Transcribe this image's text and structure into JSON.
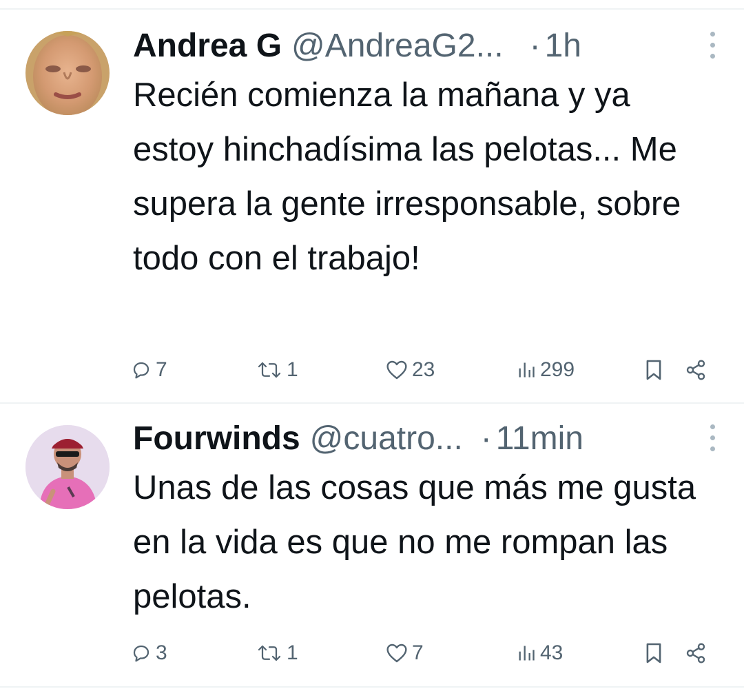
{
  "tweets": [
    {
      "display_name": "Andrea G",
      "handle": "@AndreaG2...",
      "separator": "·",
      "time": "1h",
      "text": "Recién comienza la mañana y ya estoy hinchadísima las pelotas... Me supera la gente irresponsable, sobre todo con el trabajo!",
      "replies": "7",
      "retweets": "1",
      "likes": "23",
      "views": "299",
      "avatar_icon": "user-photo-woman"
    },
    {
      "display_name": "Fourwinds",
      "handle": "@cuatro...",
      "separator": "·",
      "time": "11min",
      "text": "Unas de las cosas que más me gusta en la vida es que no me rompan las pelotas.",
      "replies": "3",
      "retweets": "1",
      "likes": "7",
      "views": "43",
      "avatar_icon": "user-photo-man-cap"
    }
  ],
  "icons": {
    "reply": "reply-icon",
    "retweet": "retweet-icon",
    "like": "heart-icon",
    "views": "views-icon",
    "bookmark": "bookmark-icon",
    "share": "share-icon",
    "more": "more-icon"
  },
  "colors": {
    "text": "#0f1419",
    "secondary": "#536471",
    "divider": "#eff3f4"
  }
}
